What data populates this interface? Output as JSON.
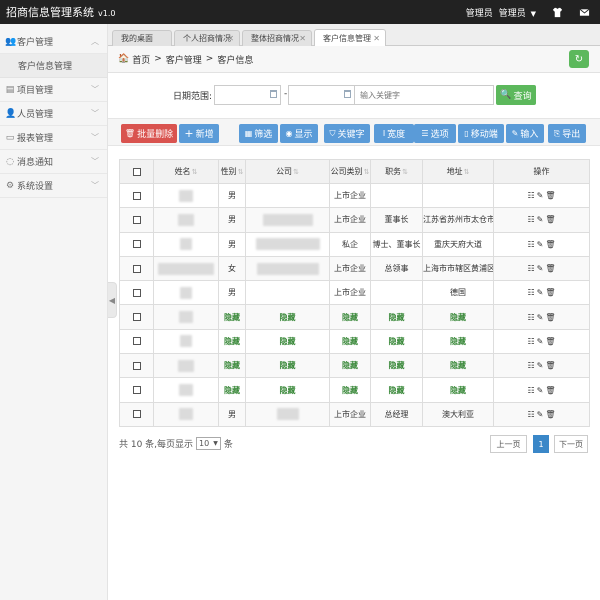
{
  "app": {
    "title": "招商信息管理系统",
    "version": "v1.0"
  },
  "header": {
    "role_label": "管理员",
    "user_label": "管理员",
    "dropdown_icon": "chevron-down-icon",
    "shirt_icon": "shirt-icon",
    "mail_icon": "mail-icon"
  },
  "sidebar": {
    "items": [
      {
        "label": "客户管理",
        "icon": "users-icon",
        "expanded": true,
        "children": [
          {
            "label": "客户信息管理"
          }
        ]
      },
      {
        "label": "项目管理",
        "icon": "folder-icon"
      },
      {
        "label": "人员管理",
        "icon": "user-icon"
      },
      {
        "label": "报表管理",
        "icon": "report-icon"
      },
      {
        "label": "消息通知",
        "icon": "message-icon"
      },
      {
        "label": "系统设置",
        "icon": "gear-icon"
      }
    ]
  },
  "tabs": [
    {
      "label": "我的桌面",
      "closable": false
    },
    {
      "label": "个人招商情况",
      "closable": true
    },
    {
      "label": "整体招商情况",
      "closable": true
    },
    {
      "label": "客户信息管理",
      "closable": true,
      "active": true
    }
  ],
  "breadcrumb": {
    "items": [
      "首页",
      "客户管理",
      "客户信息"
    ],
    "separator": ">"
  },
  "search": {
    "date_label": "日期范围:",
    "date_start": "",
    "date_end": "",
    "range_separator": "-",
    "keyword_placeholder": "输入关键字",
    "query_label": "查询"
  },
  "toolbar": {
    "buttons": [
      {
        "label": "批量删除",
        "icon": "trash-icon",
        "style": "danger"
      },
      {
        "label": "新增",
        "icon": "plus-icon",
        "style": "primary"
      },
      {
        "label": "筛选",
        "icon": "filter-icon",
        "style": "primary"
      },
      {
        "label": "显示",
        "icon": "eye-icon",
        "style": "primary"
      },
      {
        "label": "关键字",
        "icon": "shield-icon",
        "style": "primary"
      },
      {
        "label": "宽度",
        "icon": "text-width-icon",
        "style": "primary"
      },
      {
        "label": "选项",
        "icon": "list-icon",
        "style": "primary"
      },
      {
        "label": "移动端",
        "icon": "mobile-icon",
        "style": "primary"
      },
      {
        "label": "输入",
        "icon": "pencil-icon",
        "style": "primary"
      },
      {
        "label": "导出",
        "icon": "export-icon",
        "style": "primary"
      }
    ]
  },
  "table": {
    "columns": [
      {
        "label": "",
        "checkbox": true
      },
      {
        "label": "姓名",
        "sortable": true
      },
      {
        "label": "性别",
        "sortable": true
      },
      {
        "label": "公司",
        "sortable": true
      },
      {
        "label": "公司类别",
        "sortable": true
      },
      {
        "label": "职务",
        "sortable": true
      },
      {
        "label": "地址",
        "sortable": true
      },
      {
        "label": "操作",
        "sortable": false
      }
    ],
    "hidden_text": "隐藏",
    "rows": [
      {
        "name": "",
        "gender": "男",
        "company": "",
        "company_type": "上市企业",
        "position": "",
        "address": "",
        "hidden": false,
        "blur": {
          "name": 14,
          "company": 0
        }
      },
      {
        "name": "",
        "gender": "男",
        "company": "",
        "company_type": "上市企业",
        "position": "董事长",
        "address": "江苏省苏州市太仓市",
        "hidden": false,
        "blur": {
          "name": 16,
          "company": 50
        }
      },
      {
        "name": "",
        "gender": "男",
        "company": "",
        "company_type": "私企",
        "position": "博士、董事长",
        "address": "重庆天府大道",
        "hidden": false,
        "blur": {
          "name": 12,
          "company": 64
        }
      },
      {
        "name": "",
        "gender": "女",
        "company": "",
        "company_type": "上市企业",
        "position": "总领事",
        "address": "上海市市辖区黄浦区",
        "hidden": false,
        "blur": {
          "name": 56,
          "company": 62
        }
      },
      {
        "name": "",
        "gender": "男",
        "company": "",
        "company_type": "上市企业",
        "position": "",
        "address": "德国",
        "hidden": false,
        "blur": {
          "name": 12,
          "company": 0
        }
      },
      {
        "hidden": true,
        "blur": {
          "name": 14
        }
      },
      {
        "hidden": true,
        "blur": {
          "name": 12
        }
      },
      {
        "hidden": true,
        "blur": {
          "name": 16
        }
      },
      {
        "hidden": true,
        "blur": {
          "name": 14
        }
      },
      {
        "name": "",
        "gender": "男",
        "company": "",
        "company_type": "上市企业",
        "position": "总经理",
        "address": "澳大利亚",
        "hidden": false,
        "blur": {
          "name": 14,
          "company": 22
        }
      }
    ],
    "row_actions": [
      "list-icon",
      "pencil-icon",
      "trash-icon"
    ]
  },
  "footer": {
    "total_prefix": "共 10 条,每页显示",
    "page_size": "10",
    "total_suffix": "条",
    "prev_label": "上一页",
    "current_page": "1",
    "next_label": "下一页"
  },
  "colors": {
    "accent_green": "#5cb85c",
    "accent_blue": "#5a9bd8",
    "danger_red": "#d9534f",
    "topbar": "#222222",
    "hidden_text": "#3c8a3c"
  }
}
